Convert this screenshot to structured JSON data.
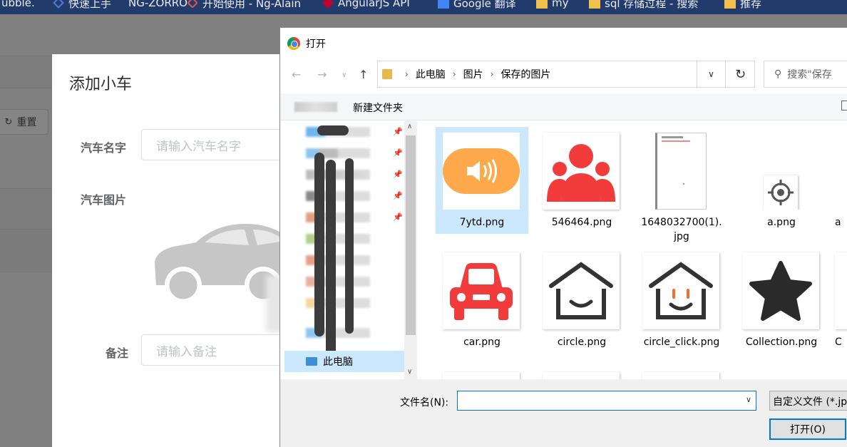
{
  "bookmarks": [
    {
      "label": "ubble.",
      "icon": "none"
    },
    {
      "label": "快速上手",
      "icon": "vue-icon"
    },
    {
      "label": "NG-ZORRO",
      "icon": "none"
    },
    {
      "label": "开始使用 - Ng-Alain",
      "icon": "ng-alain-icon"
    },
    {
      "label": "AngularJS API",
      "icon": "angular-icon"
    },
    {
      "label": "Google 翻译",
      "icon": "translate-icon"
    },
    {
      "label": "my",
      "icon": "folder-icon"
    },
    {
      "label": "sql 存储过程 - 搜索",
      "icon": "folder-icon"
    },
    {
      "label": "推荐",
      "icon": "folder-icon"
    }
  ],
  "page": {
    "reset_label": "重置"
  },
  "car_dialog": {
    "title": "添加小车",
    "name_label": "汽车名字",
    "name_placeholder": "请输入汽车名字",
    "image_label": "汽车图片",
    "remark_label": "备注",
    "remark_placeholder": "请输入备注"
  },
  "file_dialog": {
    "title": "打开",
    "breadcrumbs": [
      "此电脑",
      "图片",
      "保存的图片"
    ],
    "search_placeholder": "搜索\"保存",
    "new_folder_label": "新建文件夹",
    "nav_this_pc": "此电脑",
    "files": [
      {
        "name": "7ytd.png",
        "selected": true,
        "kind": "speaker"
      },
      {
        "name": "546464.png",
        "selected": false,
        "kind": "users"
      },
      {
        "name": "1648032700(1).\njpg",
        "selected": false,
        "kind": "doc"
      },
      {
        "name": "a.png",
        "selected": false,
        "kind": "target"
      },
      {
        "name": "car.png",
        "selected": false,
        "kind": "car"
      },
      {
        "name": "circle.png",
        "selected": false,
        "kind": "house"
      },
      {
        "name": "circle_click.png",
        "selected": false,
        "kind": "house-click"
      },
      {
        "name": "Collection.png",
        "selected": false,
        "kind": "star"
      }
    ],
    "filename_label": "文件名(N):",
    "filename_value": "",
    "filter_value": "自定义文件 (*.jp",
    "open_label": "打开(O)"
  },
  "colors": {
    "accent_blue": "#0078d7",
    "selection": "#cce8ff",
    "speaker_orange": "#ffa94d",
    "icon_red": "#f23c3c"
  }
}
